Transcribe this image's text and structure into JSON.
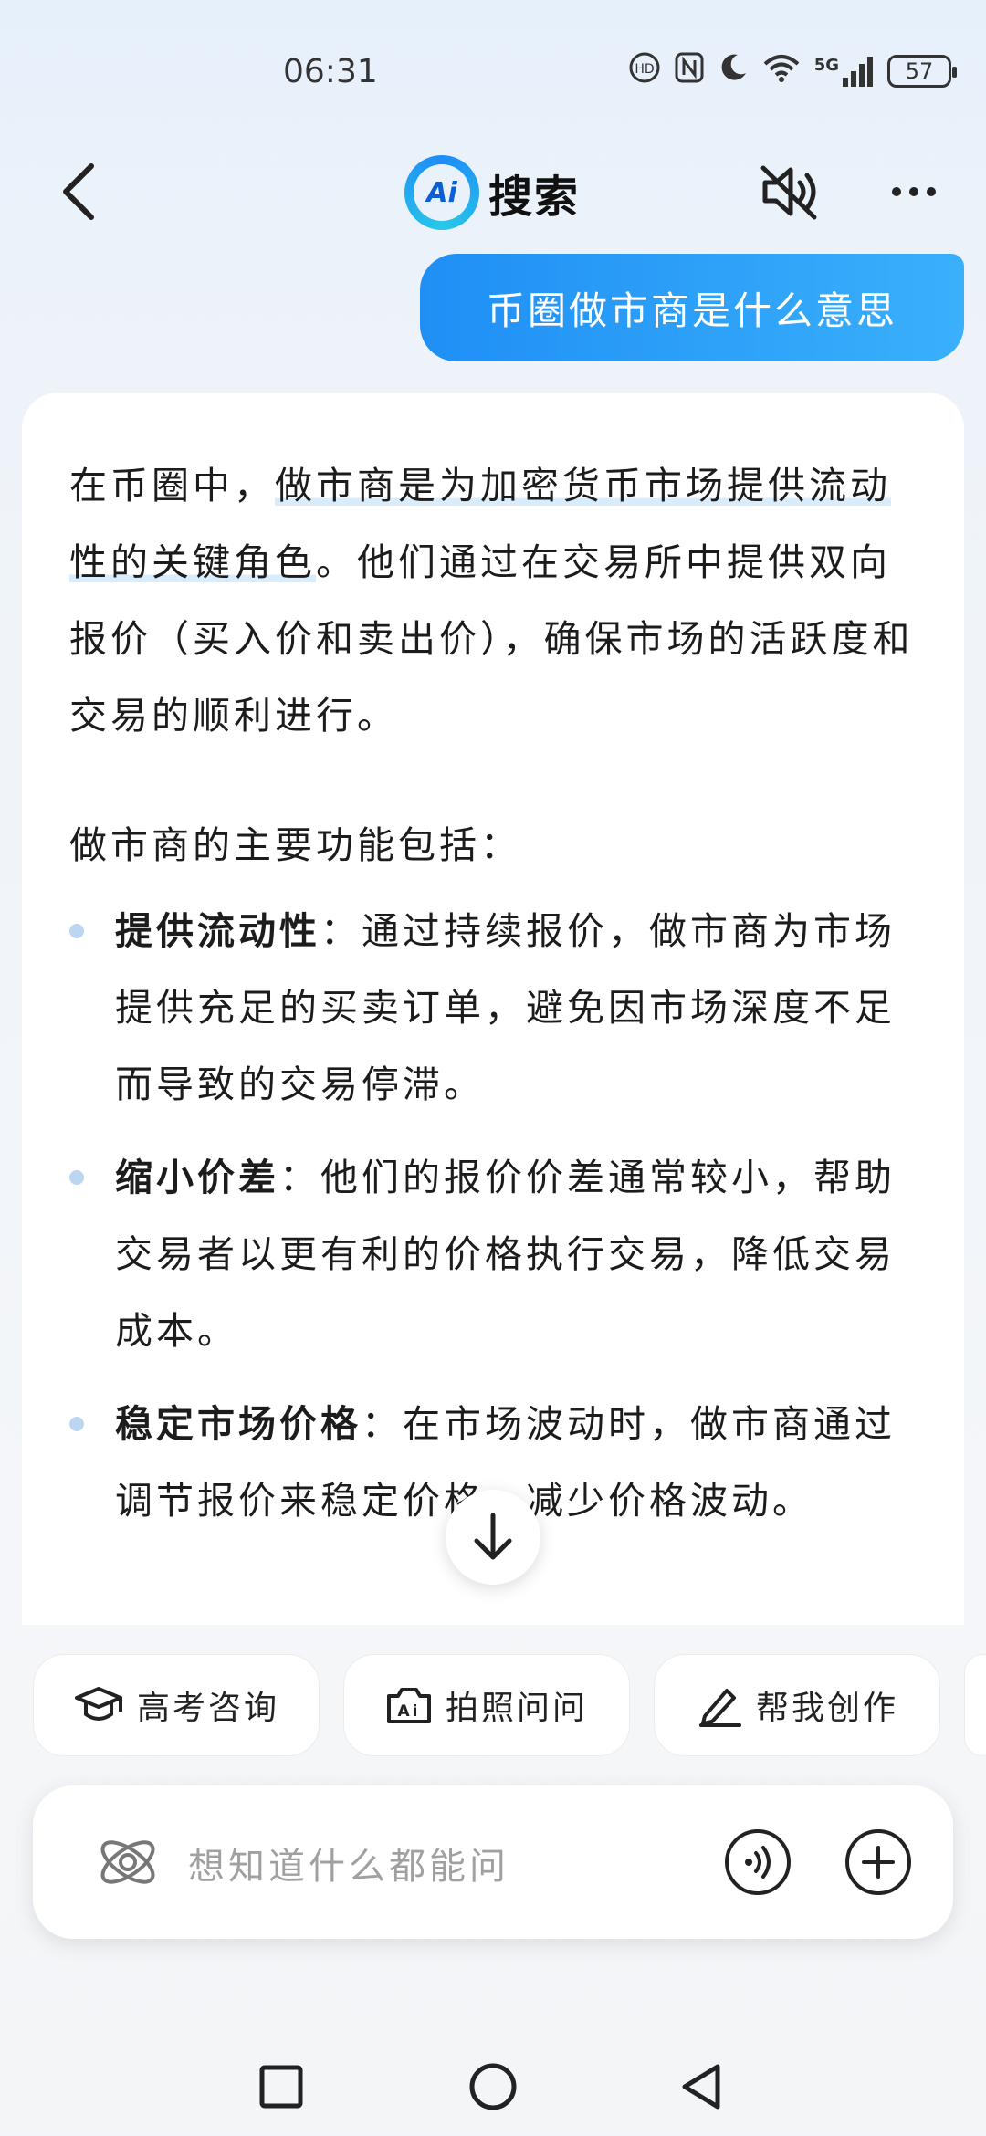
{
  "status_bar": {
    "time": "06:31",
    "network": "5G",
    "battery": "57"
  },
  "header": {
    "brand_badge": "Ai",
    "title": "搜索"
  },
  "user_message": "币圈做市商是什么意思",
  "answer": {
    "intro_a": "在币圈中，",
    "intro_highlight_a": "做市商是为加密货币市场提供",
    "intro_highlight_b": "流动性的关键角色",
    "intro_b": "。他们通过在交易所中提供双向报价（买入价和卖出价），确保市场的活跃度和交易的顺利进行。",
    "lead": "做市商的主要功能包括：",
    "bullets": [
      {
        "title": "提供流动性",
        "text": "：通过持续报价，做市商为市场提供充足的买卖订单，避免因市场深度不足而导致的交易停滞。"
      },
      {
        "title": "缩小价差",
        "text": "：他们的报价价差通常较小，帮助交易者以更有利的价格执行交易，降低交易成本。"
      },
      {
        "title": "稳定市场价格",
        "text": "：在市场波动时，做市商通过调节报价来稳定价格，减少价格波动。"
      }
    ]
  },
  "quick_actions": [
    {
      "label": "高考咨询",
      "icon": "graduation-cap-icon"
    },
    {
      "label": "拍照问问",
      "icon": "camera-ai-icon"
    },
    {
      "label": "帮我创作",
      "icon": "pen-icon"
    }
  ],
  "input": {
    "placeholder": "想知道什么都能问"
  },
  "colors": {
    "accent": "#1f8ff5",
    "highlight": "#d8ecfb"
  }
}
